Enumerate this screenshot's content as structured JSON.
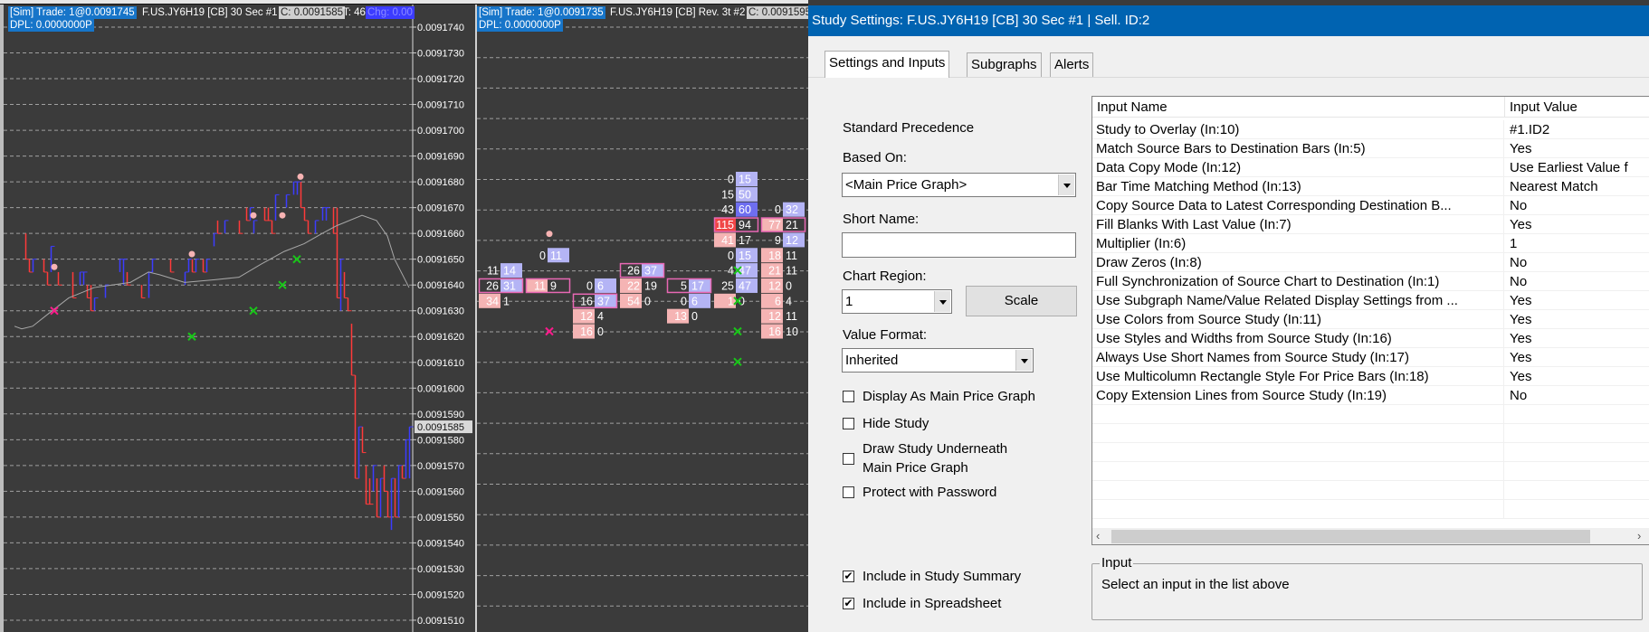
{
  "left_chart": {
    "header": {
      "sim_trade": "[Sim]  Trade: 1@0.0091745",
      "symbol": "F.US.JY6H19 [CB]  30 Sec   #1",
      "close": "C: 0.0091585",
      "ticks": "T: 46",
      "change": "Chg: 0.00",
      "dpl": "DPL: 0.0000000P"
    },
    "price_axis": {
      "labels": [
        "0.0091740",
        "0.0091730",
        "0.0091720",
        "0.0091710",
        "0.0091700",
        "0.0091690",
        "0.0091680",
        "0.0091670",
        "0.0091660",
        "0.0091650",
        "0.0091640",
        "0.0091630",
        "0.0091620",
        "0.0091610",
        "0.0091600",
        "0.0091590",
        "0.0091580",
        "0.0091570",
        "0.0091560",
        "0.0091550",
        "0.0091540",
        "0.0091530",
        "0.0091520",
        "0.0091510"
      ],
      "current_price": "0.0091585"
    },
    "colors": {
      "up": "#3c3cff",
      "down": "#ff3a3a",
      "ma": "#a8a8a8",
      "dot": "#f7b3b3",
      "sell_x": "#ff1a8c",
      "buy_x": "#19c619"
    },
    "bars": [
      [
        6,
        0.009166,
        0.009165,
        "d"
      ],
      [
        7,
        0.009165,
        0.0091645,
        "d"
      ],
      [
        8,
        0.009165,
        0.0091645,
        "u"
      ],
      [
        11,
        0.009165,
        0.0091645,
        "d"
      ],
      [
        12,
        0.0091645,
        0.009164,
        "d"
      ],
      [
        13,
        0.0091655,
        0.0091645,
        "u"
      ],
      [
        15,
        0.0091645,
        0.009164,
        "d"
      ],
      [
        19,
        0.0091645,
        0.0091635,
        "d"
      ],
      [
        21,
        0.0091645,
        0.009164,
        "u"
      ],
      [
        22,
        0.0091645,
        0.009164,
        "u"
      ],
      [
        23,
        0.009164,
        0.0091635,
        "d"
      ],
      [
        24,
        0.009164,
        0.009163,
        "d"
      ],
      [
        25,
        0.0091635,
        0.009163,
        "u"
      ],
      [
        28,
        0.009164,
        0.0091635,
        "u"
      ],
      [
        32,
        0.009165,
        0.0091645,
        "u"
      ],
      [
        33,
        0.009165,
        0.009164,
        "u"
      ],
      [
        34,
        0.0091645,
        0.009164,
        "d"
      ],
      [
        38,
        0.009164,
        0.0091635,
        "d"
      ],
      [
        40,
        0.0091645,
        0.0091635,
        "u"
      ],
      [
        41,
        0.009165,
        0.0091645,
        "u"
      ],
      [
        46,
        0.009165,
        0.0091645,
        "d"
      ],
      [
        50,
        0.0091645,
        0.009164,
        "u"
      ],
      [
        51,
        0.009165,
        0.0091645,
        "u"
      ],
      [
        52,
        0.009165,
        0.0091645,
        "d"
      ],
      [
        53,
        0.009165,
        0.0091645,
        "u"
      ],
      [
        55,
        0.009165,
        0.0091645,
        "d"
      ],
      [
        56,
        0.009165,
        0.0091645,
        "u"
      ],
      [
        58,
        0.009166,
        0.0091655,
        "u"
      ],
      [
        59,
        0.0091665,
        0.009166,
        "d"
      ],
      [
        61,
        0.0091665,
        0.009166,
        "u"
      ],
      [
        65,
        0.0091665,
        0.009166,
        "d"
      ],
      [
        67,
        0.009167,
        0.0091665,
        "d"
      ],
      [
        68,
        0.009167,
        0.0091665,
        "u"
      ],
      [
        69,
        0.0091665,
        0.009166,
        "u"
      ],
      [
        72,
        0.009167,
        0.0091665,
        "d"
      ],
      [
        73,
        0.009167,
        0.0091665,
        "d"
      ],
      [
        74,
        0.0091665,
        0.009166,
        "d"
      ],
      [
        75,
        0.0091675,
        0.0091665,
        "u"
      ],
      [
        78,
        0.0091675,
        0.009167,
        "u"
      ],
      [
        80,
        0.009168,
        0.0091675,
        "u"
      ],
      [
        81,
        0.009168,
        0.0091675,
        "u"
      ],
      [
        82,
        0.009168,
        0.009167,
        "d"
      ],
      [
        83,
        0.009167,
        0.0091665,
        "d"
      ],
      [
        84,
        0.0091665,
        0.009166,
        "d"
      ],
      [
        86,
        0.0091665,
        0.009166,
        "u"
      ],
      [
        88,
        0.009167,
        0.0091665,
        "u"
      ],
      [
        89,
        0.009167,
        0.0091665,
        "u"
      ],
      [
        91,
        0.009167,
        0.009166,
        "d"
      ],
      [
        92,
        0.009167,
        0.0091635,
        "d"
      ],
      [
        93,
        0.009165,
        0.009163,
        "u"
      ],
      [
        94,
        0.0091645,
        0.0091635,
        "d"
      ],
      [
        95,
        0.0091635,
        0.009163,
        "d"
      ],
      [
        96,
        0.0091625,
        0.0091605,
        "d"
      ],
      [
        97,
        0.0091605,
        0.0091565,
        "d"
      ],
      [
        98,
        0.0091585,
        0.0091565,
        "u"
      ],
      [
        99,
        0.0091585,
        0.0091575,
        "d"
      ],
      [
        100,
        0.009157,
        0.0091555,
        "d"
      ],
      [
        101,
        0.0091565,
        0.0091555,
        "d"
      ],
      [
        102,
        0.009157,
        0.009156,
        "u"
      ],
      [
        103,
        0.0091565,
        0.009155,
        "d"
      ],
      [
        104,
        0.0091565,
        0.009155,
        "u"
      ],
      [
        105,
        0.009157,
        0.009156,
        "d"
      ],
      [
        106,
        0.009156,
        0.009155,
        "d"
      ],
      [
        107,
        0.0091565,
        0.0091545,
        "u"
      ],
      [
        108,
        0.0091565,
        0.009155,
        "d"
      ],
      [
        109,
        0.009157,
        0.009155,
        "u"
      ],
      [
        110,
        0.009157,
        0.0091565,
        "d"
      ],
      [
        111,
        0.009158,
        0.0091565,
        "u"
      ],
      [
        112,
        0.0091585,
        0.0091565,
        "u"
      ]
    ],
    "moving_average": [
      [
        3,
        0.0091624
      ],
      [
        5,
        0.0091623
      ],
      [
        8,
        0.0091624
      ],
      [
        12.5,
        0.0091629
      ],
      [
        18,
        0.0091635
      ],
      [
        25,
        0.0091639
      ],
      [
        35,
        0.0091641
      ],
      [
        40,
        0.0091645
      ],
      [
        43,
        0.0091644
      ],
      [
        50,
        0.0091641
      ],
      [
        58,
        0.0091642
      ],
      [
        65,
        0.0091643
      ],
      [
        71,
        0.0091648
      ],
      [
        77.5,
        0.0091653
      ],
      [
        83,
        0.0091656
      ],
      [
        88,
        0.009166
      ],
      [
        92,
        0.0091663
      ],
      [
        99,
        0.0091667
      ],
      [
        103,
        0.0091665
      ],
      [
        106,
        0.0091659
      ],
      [
        108,
        0.009165
      ],
      [
        112,
        0.0091639
      ]
    ],
    "dots": [
      [
        14,
        0.0091647
      ],
      [
        52,
        0.0091652
      ],
      [
        69,
        0.0091667
      ],
      [
        77,
        0.0091667
      ],
      [
        82,
        0.0091682
      ]
    ],
    "sell_marks": [
      [
        14,
        0.009163
      ]
    ],
    "buy_marks": [
      [
        52,
        0.009162
      ],
      [
        69,
        0.009163
      ],
      [
        77,
        0.009164
      ],
      [
        81,
        0.009165
      ]
    ]
  },
  "mid_chart": {
    "header": {
      "sim_trade": "[Sim]  Trade: 1@0.0091735",
      "symbol": "F.US.JY6H19 [CB]  Rev. 3t  #2",
      "close": "C: 0.0091595",
      "dpl": "DPL: 0.0000000P"
    },
    "cell_colors": {
      "p": "#f5b4b4",
      "b": "#b4b4f5",
      "r": "#f04646",
      "B": "#6e6ef0",
      "box": "#e868b4"
    },
    "footprint_columns": [
      [
        [
          0.009166,
          "11",
          "14",
          "",
          "b",
          0
        ],
        [
          0.0091655,
          "26",
          "31",
          "",
          "b",
          1
        ],
        [
          0.009165,
          "34",
          "1",
          "p",
          "",
          0
        ]
      ],
      [
        [
          0.0091665,
          "0",
          "11",
          "",
          "b",
          0
        ],
        [
          0.0091655,
          "11",
          "9",
          "p",
          "",
          1
        ]
      ],
      [
        [
          0.0091655,
          "0",
          "6",
          "",
          "b",
          0
        ],
        [
          0.009165,
          "16",
          "37",
          "",
          "b",
          1
        ],
        [
          0.0091645,
          "12",
          "4",
          "p",
          "",
          0
        ],
        [
          0.009164,
          "16",
          "0",
          "p",
          "",
          0
        ]
      ],
      [
        [
          0.009166,
          "26",
          "37",
          "",
          "b",
          1
        ],
        [
          0.0091655,
          "22",
          "19",
          "p",
          "",
          0
        ],
        [
          0.009165,
          "54",
          "0",
          "p",
          "",
          0
        ]
      ],
      [
        [
          0.0091655,
          "5",
          "17",
          "",
          "b",
          1
        ],
        [
          0.009165,
          "0",
          "6",
          "",
          "b",
          0
        ],
        [
          0.0091645,
          "13",
          "0",
          "p",
          "",
          0
        ]
      ],
      [
        [
          0.009169,
          "0",
          "15",
          "",
          "b",
          0
        ],
        [
          0.0091685,
          "15",
          "50",
          "",
          "b",
          0
        ],
        [
          0.009168,
          "43",
          "60",
          "",
          "B",
          0
        ],
        [
          0.0091675,
          "115",
          "94",
          "r",
          "",
          1
        ],
        [
          0.009167,
          "41",
          "17",
          "p",
          "",
          0
        ],
        [
          0.0091665,
          "0",
          "15",
          "",
          "b",
          0
        ],
        [
          0.009166,
          "4",
          "47",
          "",
          "b",
          0
        ],
        [
          0.0091655,
          "25",
          "47",
          "",
          "b",
          0
        ],
        [
          0.009165,
          "1",
          "0",
          "p",
          "",
          0
        ]
      ],
      [
        [
          0.009168,
          "0",
          "32",
          "",
          "b",
          0
        ],
        [
          0.0091675,
          "77",
          "21",
          "p",
          "",
          1
        ],
        [
          0.009167,
          "9",
          "12",
          "",
          "b",
          0
        ],
        [
          0.0091665,
          "18",
          "11",
          "p",
          "",
          0
        ],
        [
          0.009166,
          "21",
          "11",
          "p",
          "",
          0
        ],
        [
          0.0091655,
          "12",
          "0",
          "p",
          "",
          0
        ],
        [
          0.009165,
          "6",
          "4",
          "p",
          "",
          0
        ],
        [
          0.0091645,
          "12",
          "11",
          "p",
          "",
          0
        ],
        [
          0.009164,
          "16",
          "10",
          "p",
          "",
          0
        ]
      ]
    ],
    "dots": [
      [
        1,
        0.0091672
      ]
    ],
    "sell_marks": [
      [
        1,
        0.009164
      ]
    ],
    "buy_marks": [
      [
        5,
        0.009166
      ],
      [
        5,
        0.009165
      ],
      [
        5,
        0.009164
      ],
      [
        5,
        0.009163
      ]
    ]
  },
  "dialog": {
    "title": "Study Settings: F.US.JY6H19 [CB]  30 Sec   #1 | Sell. ID:2",
    "tabs": [
      {
        "label": "Settings and Inputs",
        "active": true
      },
      {
        "label": "Subgraphs",
        "active": false
      },
      {
        "label": "Alerts",
        "active": false
      }
    ],
    "standard_precedence": "Standard Precedence",
    "based_on_label": "Based On:",
    "based_on_value": "<Main Price Graph>",
    "short_name_label": "Short Name:",
    "short_name_value": "",
    "chart_region_label": "Chart Region:",
    "chart_region_value": "1",
    "scale_button": "Scale",
    "value_format_label": "Value Format:",
    "value_format_value": "Inherited",
    "checkboxes": [
      {
        "label": "Display As Main Price Graph",
        "checked": false
      },
      {
        "label": "Hide Study",
        "checked": false
      },
      {
        "label": "Draw Study Underneath",
        "label2": "Main Price Graph",
        "checked": false
      },
      {
        "label": "Protect with Password",
        "checked": false
      },
      {
        "label": "Include in Study Summary",
        "checked": true
      },
      {
        "label": "Include in Spreadsheet",
        "checked": true
      }
    ],
    "inputs_table": {
      "headers": [
        "Input Name",
        "Input Value"
      ],
      "rows": [
        [
          "Study to Overlay    (In:10)",
          "#1.ID2"
        ],
        [
          "Match Source Bars to Destination Bars    (In:5)",
          "Yes"
        ],
        [
          "Data Copy Mode    (In:12)",
          "Use Earliest Value f"
        ],
        [
          "Bar Time Matching Method    (In:13)",
          "Nearest Match"
        ],
        [
          "Copy Source Data to Latest Corresponding Destination B...",
          "No"
        ],
        [
          "Fill Blanks With Last Value    (In:7)",
          "Yes"
        ],
        [
          "Multiplier    (In:6)",
          "1"
        ],
        [
          "Draw Zeros    (In:8)",
          "No"
        ],
        [
          "Full Synchronization of Source Chart to Destination    (In:1)",
          "No"
        ],
        [
          "Use Subgraph Name/Value Related Display Settings from ...",
          "Yes"
        ],
        [
          "Use Colors from Source Study    (In:11)",
          "Yes"
        ],
        [
          "Use Styles and Widths from Source Study    (In:16)",
          "Yes"
        ],
        [
          "Always Use Short Names from Source Study    (In:17)",
          "Yes"
        ],
        [
          "Use Multicolumn Rectangle Style For Price Bars    (In:18)",
          "Yes"
        ],
        [
          "Copy Extension Lines from Source Study    (In:19)",
          "No"
        ]
      ]
    },
    "input_group": {
      "title": "Input",
      "text": "Select an input in the list above"
    }
  }
}
